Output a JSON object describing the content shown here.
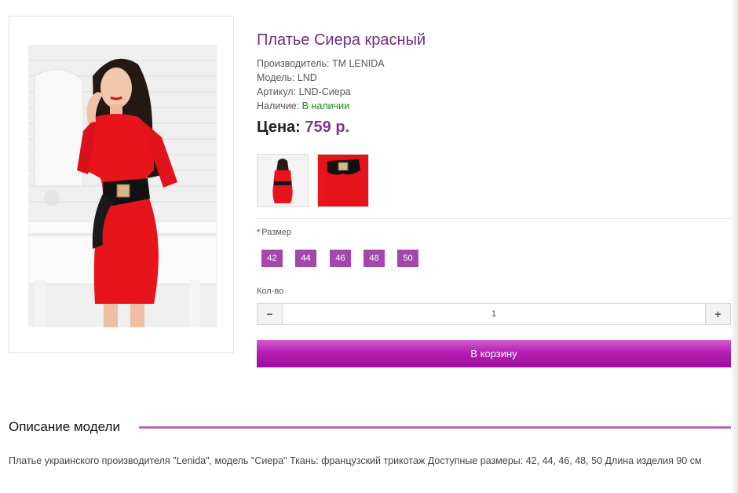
{
  "product": {
    "title": "Платье Сиера красный",
    "manufacturer_label": "Производитель:",
    "manufacturer_value": "TM LENIDA",
    "model_label": "Модель:",
    "model_value": "LND",
    "sku_label": "Артикул:",
    "sku_value": "LND-Сиера",
    "stock_label": "Наличие:",
    "stock_value": "В наличии",
    "price_label": "Цена:",
    "price_value": "759 р."
  },
  "options": {
    "size_label": "Размер",
    "sizes": [
      "42",
      "44",
      "46",
      "48",
      "50"
    ],
    "qty_label": "Кол-во",
    "qty_value": "1",
    "qty_minus": "−",
    "qty_plus": "+"
  },
  "cart": {
    "button_label": "В корзину"
  },
  "description": {
    "heading": "Описание модели",
    "text": "Платье украинского производителя \"Lenida\", модель \"Сиера\" Ткань: французский трикотаж Доступные размеры: 42, 44, 46, 48, 50 Длина изделия 90 см"
  },
  "colors": {
    "title": "#6e2f7f",
    "accent": "#a347ad",
    "in_stock": "#1a8a1a",
    "dress": "#e8141c"
  }
}
